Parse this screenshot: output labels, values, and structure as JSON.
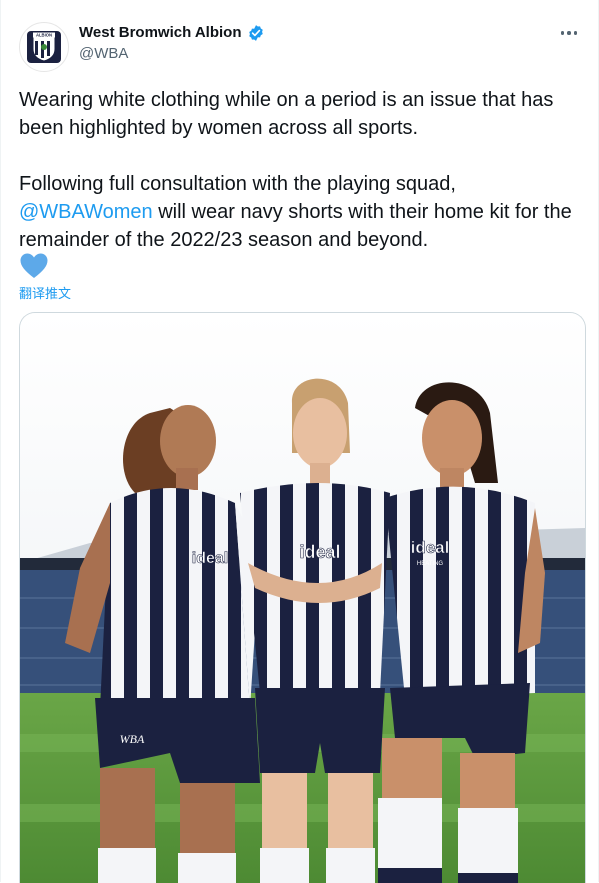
{
  "tweet": {
    "author_name": "West Bromwich Albion",
    "handle": "@WBA",
    "paragraph1": "Wearing white clothing while on a period is an issue that has been highlighted by women across all sports.",
    "paragraph2_prefix": "Following full consultation with the playing squad,",
    "mention": "@WBAWomen",
    "paragraph2_suffix": " will wear navy shorts with their home kit for the remainder of the 2022/23 season and beyond.",
    "translate_label": "翻译推文",
    "avatar_crest_text": "ALBION"
  },
  "media": {
    "sponsor_text": "ideal",
    "sponsor_sub": "HEATING",
    "crest_text": "WBA"
  },
  "colors": {
    "verified_badge": "#1d9bf0",
    "link": "#1d9bf0",
    "heart": "#5da9e9",
    "navy": "#1b2140",
    "pitch": "#5f9a3e"
  },
  "icons": {
    "verified": "verified-badge-icon",
    "more": "more-options-icon",
    "heart": "blue-heart-emoji-icon"
  }
}
